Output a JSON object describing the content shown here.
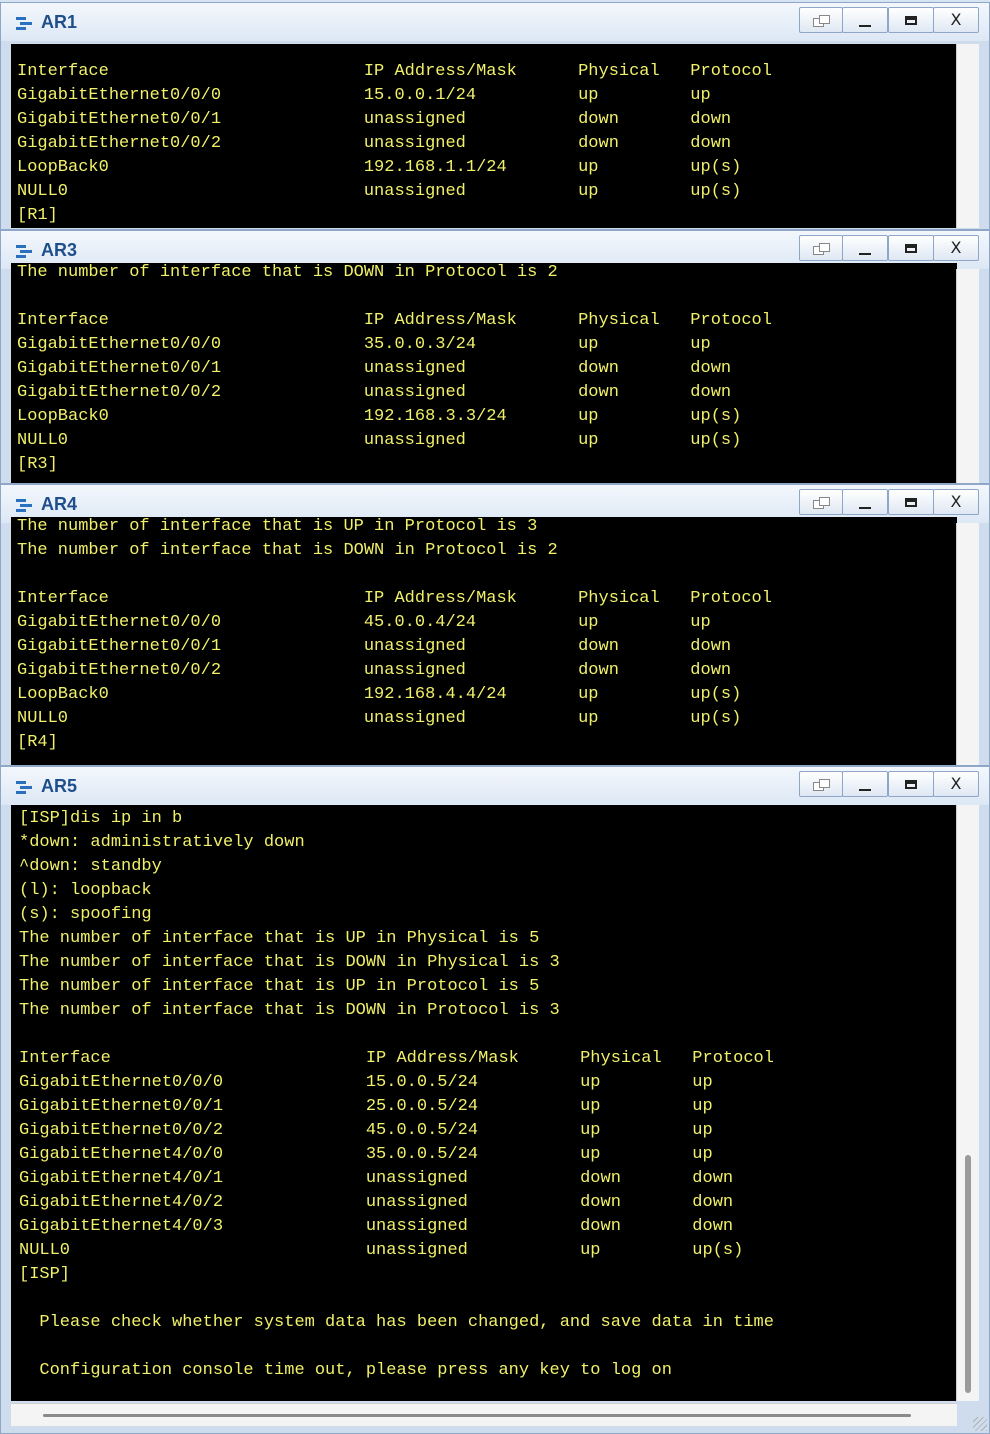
{
  "windows": [
    {
      "title": "AR1",
      "lines": [
        "Interface                         IP Address/Mask      Physical   Protocol",
        "GigabitEthernet0/0/0              15.0.0.1/24          up         up",
        "GigabitEthernet0/0/1              unassigned           down       down",
        "GigabitEthernet0/0/2              unassigned           down       down",
        "LoopBack0                         192.168.1.1/24       up         up(s)",
        "NULL0                             unassigned           up         up(s)",
        "[R1]"
      ]
    },
    {
      "title": "AR3",
      "lines": [
        "The number of interface that is DOWN in Protocol is 2",
        "",
        "Interface                         IP Address/Mask      Physical   Protocol",
        "GigabitEthernet0/0/0              35.0.0.3/24          up         up",
        "GigabitEthernet0/0/1              unassigned           down       down",
        "GigabitEthernet0/0/2              unassigned           down       down",
        "LoopBack0                         192.168.3.3/24       up         up(s)",
        "NULL0                             unassigned           up         up(s)",
        "[R3]"
      ]
    },
    {
      "title": "AR4",
      "lines": [
        "The number of interface that is UP in Protocol is 3",
        "The number of interface that is DOWN in Protocol is 2",
        "",
        "Interface                         IP Address/Mask      Physical   Protocol",
        "GigabitEthernet0/0/0              45.0.0.4/24          up         up",
        "GigabitEthernet0/0/1              unassigned           down       down",
        "GigabitEthernet0/0/2              unassigned           down       down",
        "LoopBack0                         192.168.4.4/24       up         up(s)",
        "NULL0                             unassigned           up         up(s)",
        "[R4]"
      ]
    },
    {
      "title": "AR5",
      "lines": [
        "[ISP]dis ip in b",
        "*down: administratively down",
        "^down: standby",
        "(l): loopback",
        "(s): spoofing",
        "The number of interface that is UP in Physical is 5",
        "The number of interface that is DOWN in Physical is 3",
        "The number of interface that is UP in Protocol is 5",
        "The number of interface that is DOWN in Protocol is 3",
        "",
        "Interface                         IP Address/Mask      Physical   Protocol",
        "GigabitEthernet0/0/0              15.0.0.5/24          up         up",
        "GigabitEthernet0/0/1              25.0.0.5/24          up         up",
        "GigabitEthernet0/0/2              45.0.0.5/24          up         up",
        "GigabitEthernet4/0/0              35.0.0.5/24          up         up",
        "GigabitEthernet4/0/1              unassigned           down       down",
        "GigabitEthernet4/0/2              unassigned           down       down",
        "GigabitEthernet4/0/3              unassigned           down       down",
        "NULL0                             unassigned           up         up(s)",
        "[ISP]",
        "",
        "  Please check whether system data has been changed, and save data in time",
        "",
        "  Configuration console time out, please press any key to log on"
      ]
    }
  ],
  "controls": {
    "minimize": "_",
    "close": "X"
  },
  "colors": {
    "terminal_bg": "#000000",
    "terminal_text": "#f0f06a",
    "title_text": "#1f4e8c"
  }
}
